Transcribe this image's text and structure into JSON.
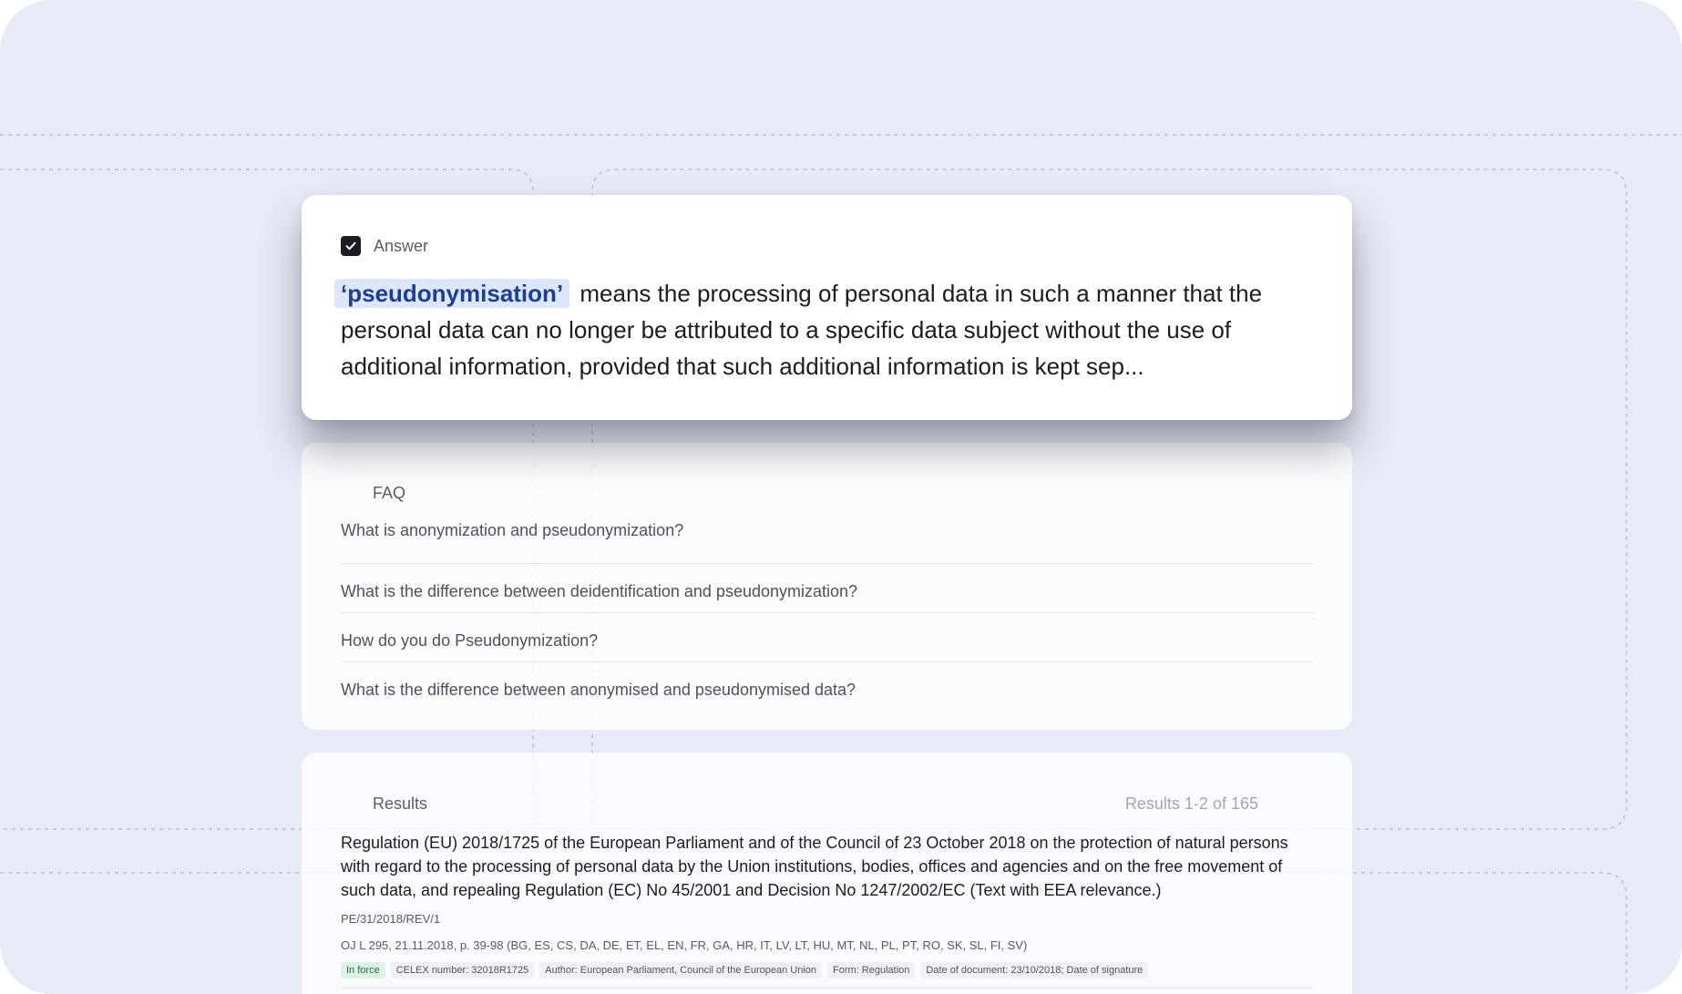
{
  "answer": {
    "title": "Answer",
    "term": "‘pseudonymisation’",
    "text": "means the processing of personal data in such a manner that the personal data can no longer be attributed to a specific data subject without the use of additional information, provided that such additional information is kept sep..."
  },
  "faq": {
    "title": "FAQ",
    "items": [
      "What is anonymization and pseudonymization?",
      "What is the difference between deidentification and pseudonymization?",
      "How do you do Pseudonymization?",
      "What is the difference between anonymised and pseudonymised data?"
    ]
  },
  "results": {
    "title": "Results",
    "count_label": "Results 1-2 of 165",
    "items": [
      {
        "title": "Regulation (EU) 2018/1725 of the European Parliament and of the Council of 23 October 2018 on the protection of natural persons with regard to the processing of personal data by the Union institutions, bodies, offices and agencies and on the free movement of such data, and repealing Regulation (EC) No 45/2001 and Decision No 1247/2002/EC (Text with EEA relevance.)",
        "reference": "PE/31/2018/REV/1",
        "journal": "OJ L 295, 21.11.2018, p. 39-98 (BG, ES, CS, DA, DE, ET, EL, EN, FR, GA, HR, IT, LV, LT, HU, MT, NL, PL, PT, RO, SK, SL, FI, SV)",
        "tags": [
          "In force",
          "CELEX number: 32018R1725",
          "Author: European Parliament, Council of the European Union",
          "Form: Regulation",
          "Date of document: 23/10/2018; Date of signature"
        ]
      }
    ]
  },
  "colors": {
    "background": "#e6ebf7",
    "highlight_bg": "#dde6fa",
    "highlight_text": "#1a3e9a",
    "status_green": "#def3e6"
  },
  "icons": {
    "answer_checkbox": "checkbox-checked-icon"
  }
}
